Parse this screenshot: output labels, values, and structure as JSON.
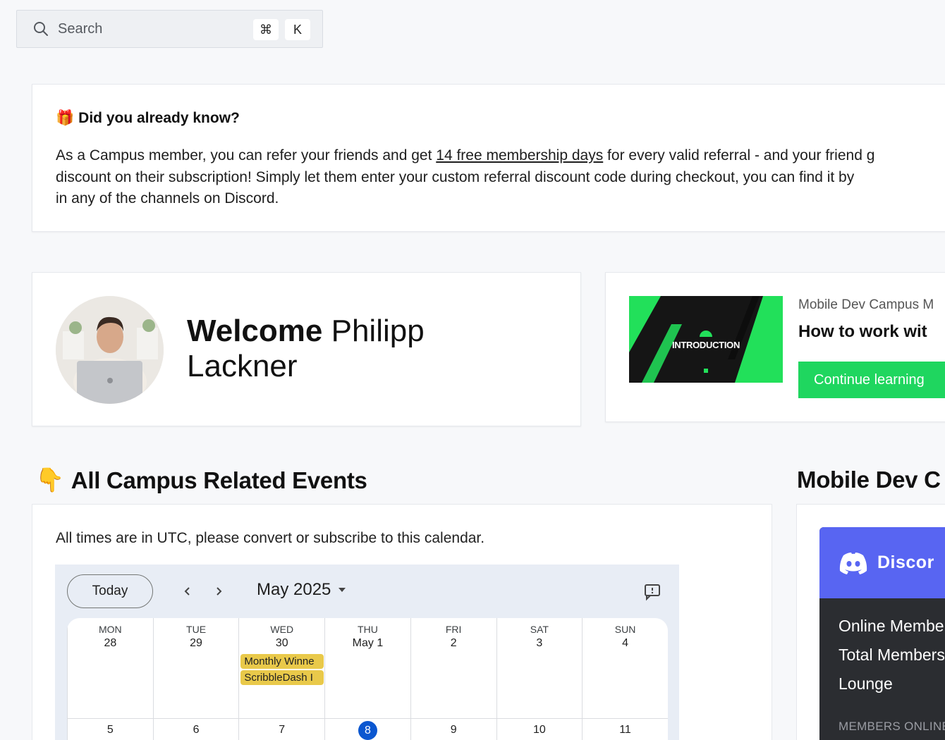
{
  "search": {
    "placeholder": "Search",
    "shortcut_cmd": "⌘",
    "shortcut_key": "K"
  },
  "info": {
    "emoji": "🎁",
    "title": "Did you already know?",
    "text_before": "As a Campus member, you can refer your friends and get ",
    "link": "14 free membership days",
    "text_after": " for every valid referral - and your friend g",
    "line2": "discount on their subscription! Simply let them enter your custom referral discount code during checkout, you can find it by",
    "line3": "in any of the channels on Discord."
  },
  "welcome": {
    "bold": "Welcome",
    "first": "Philipp",
    "last": "Lackner"
  },
  "course": {
    "label": "Mobile Dev Campus M",
    "name": "How to work wit",
    "thumb_title": "INTRODUCTION",
    "button": "Continue learning"
  },
  "events_section": {
    "emoji": "👇",
    "title": "All Campus Related Events"
  },
  "mobile_section": {
    "title": "Mobile Dev C"
  },
  "events": {
    "note": "All times are in UTC, please convert or subscribe to this calendar."
  },
  "calendar": {
    "today": "Today",
    "month": "May 2025",
    "days": [
      {
        "dow": "MON",
        "date": "28",
        "next": "5"
      },
      {
        "dow": "TUE",
        "date": "29",
        "next": "6"
      },
      {
        "dow": "WED",
        "date": "30",
        "next": "7"
      },
      {
        "dow": "THU",
        "date": "May 1",
        "next": "8"
      },
      {
        "dow": "FRI",
        "date": "2",
        "next": "9"
      },
      {
        "dow": "SAT",
        "date": "3",
        "next": "10"
      },
      {
        "dow": "SUN",
        "date": "4",
        "next": "11"
      }
    ],
    "events": [
      "Monthly Winne",
      "ScribbleDash I"
    ],
    "current_day": "8",
    "event_color": "#e9c94a",
    "current_color": "#0b57d0"
  },
  "discord": {
    "brand": "Discor",
    "online": "Online Membe",
    "total": "Total Members",
    "lounge": "Lounge",
    "members_online": "MEMBERS ONLINE"
  },
  "colors": {
    "accent_green": "#1fd65f",
    "discord_blurple": "#5865f2"
  }
}
